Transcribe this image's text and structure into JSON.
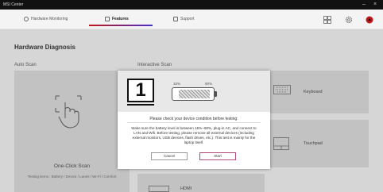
{
  "window": {
    "title": "MSI Center"
  },
  "nav": {
    "tabs": [
      {
        "label": "Hardware Monitoring"
      },
      {
        "label": "Features"
      },
      {
        "label": "Support"
      }
    ]
  },
  "page": {
    "title": "Hardware Diagnosis"
  },
  "auto_scan": {
    "section_label": "Auto Scan",
    "card_title": "One-Click Scan",
    "testing_items": "Testing items : Battery / Device / Lanes / Wi-Fi / Comfort"
  },
  "interactive_scan": {
    "section_label": "Interactive Scan",
    "items": [
      {
        "label": "Keyboard"
      },
      {
        "label": "Touchpad"
      },
      {
        "label": "HDMI"
      }
    ]
  },
  "dialog": {
    "step_number": "1",
    "battery_min_label": "15%",
    "battery_max_label": "90%",
    "battery_range_fraction": [
      0.15,
      0.9
    ],
    "title": "Please check your device condition before testing:",
    "body": "Make sure the battery level is between 15%~90%, plug-in AC, and connect to LAN and Wifi. Before testing, please remove all external devices (including external monitors, USB devices, flash drives, etc.). This test is mainly for the laptop itself.",
    "cancel_label": "Cancel",
    "start_label": "Start"
  },
  "colors": {
    "accent_red": "#c01818",
    "accent_purple": "#4a2fd0"
  }
}
